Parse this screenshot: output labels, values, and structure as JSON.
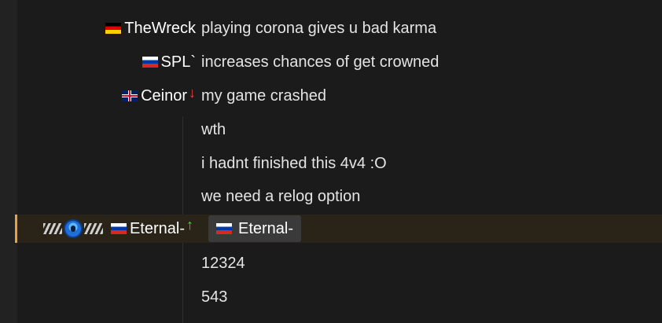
{
  "chat": {
    "messages": [
      {
        "sender": "TheWreck",
        "flag": "de",
        "text": "playing corona gives u bad karma"
      },
      {
        "sender": "SPL`",
        "flag": "ru",
        "text": "increases chances of get crowned"
      },
      {
        "sender": "Ceinor",
        "flag": "gb",
        "status": "↓",
        "text": "my game crashed"
      },
      {
        "text": "wth"
      },
      {
        "text": "i hadnt finished this 4v4 :O"
      },
      {
        "text": "we need a relog option"
      },
      {
        "sender": "Eternal-",
        "flag": "ru",
        "status": "↑",
        "mention": "Eternal-",
        "highlighted": true
      },
      {
        "text": "12324"
      },
      {
        "text": "543"
      }
    ]
  },
  "colors": {
    "background": "#1b1b1b",
    "highlight_bar": "#e8a23a",
    "arrow_down": "#ff3b3b",
    "arrow_up": "#36e036"
  },
  "icons": {
    "de_flag": "germany-flag-icon",
    "ru_flag": "russia-flag-icon",
    "gb_flag": "uk-flag-icon",
    "supporter_badge": "supporter-badge-icon"
  }
}
